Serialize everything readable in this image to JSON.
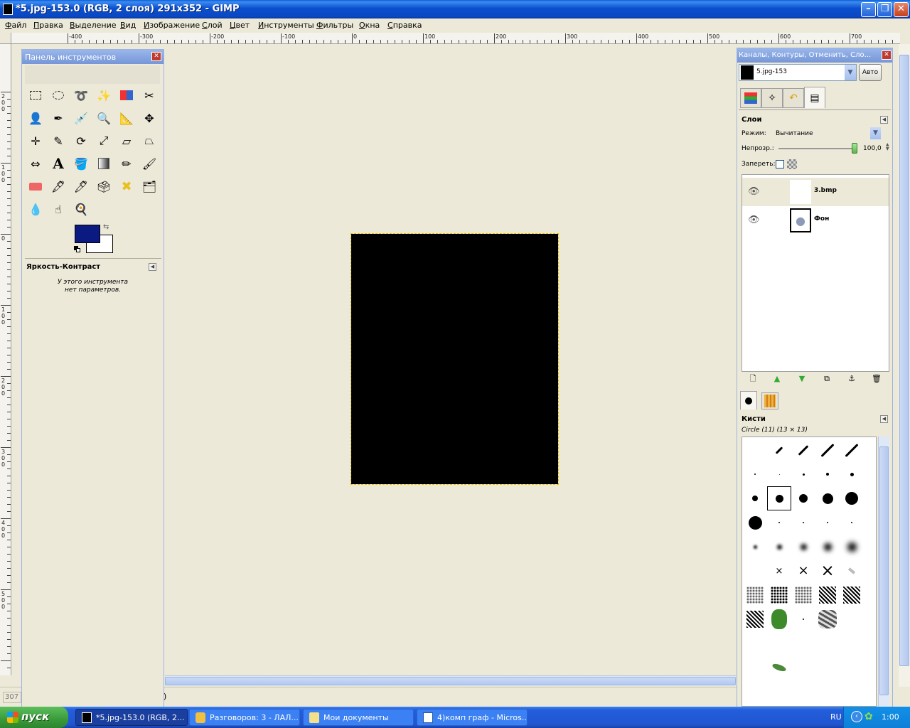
{
  "window": {
    "title": "*5.jpg-153.0 (RGB, 2 слоя) 291x352 - GIMP"
  },
  "menu": [
    "Файл",
    "Правка",
    "Выделение",
    "Вид",
    "Изображение",
    "Слой",
    "Цвет",
    "Инструменты",
    "Фильтры",
    "Окна",
    "Справка"
  ],
  "ruler": {
    "h_labels": [
      "-400",
      "-300",
      "-200",
      "-100",
      "0",
      "100",
      "200",
      "300",
      "400",
      "500",
      "600",
      "700"
    ],
    "v_labels": [
      "200",
      "100",
      "0",
      "100",
      "200",
      "300",
      "400",
      "500"
    ]
  },
  "toolbox": {
    "title": "Панель инструментов",
    "tool_options_title": "Яркость-Контраст",
    "note_line1": "У этого инструмента",
    "note_line2": "нет параметров."
  },
  "dock": {
    "title": "Каналы, Контуры, Отменить, Сло...",
    "image_select": "5.jpg-153",
    "auto_button": "Авто",
    "layers": {
      "title": "Слои",
      "mode_label": "Режим:",
      "mode_value": "Вычитание",
      "opacity_label": "Непрозр.:",
      "opacity_value": "100,0",
      "lock_label": "Запереть:",
      "items": [
        {
          "name": "3.bmp"
        },
        {
          "name": "Фон"
        }
      ]
    },
    "brushes": {
      "title": "Кисти",
      "selected": "Circle (11) (13 × 13)"
    }
  },
  "status": {
    "coord": "307",
    "paren": ")"
  },
  "taskbar": {
    "start": "пуск",
    "tasks": [
      "*5.jpg-153.0 (RGB, 2...",
      "Разговоров: 3 - ЛАЛ...",
      "Мои документы",
      "4)комп граф - Micros..."
    ],
    "lang": "RU",
    "clock": "1:00"
  },
  "colors": {
    "foreground": "#0a1a80",
    "background": "#ffffff",
    "titlebar": "#0a4fcf"
  }
}
